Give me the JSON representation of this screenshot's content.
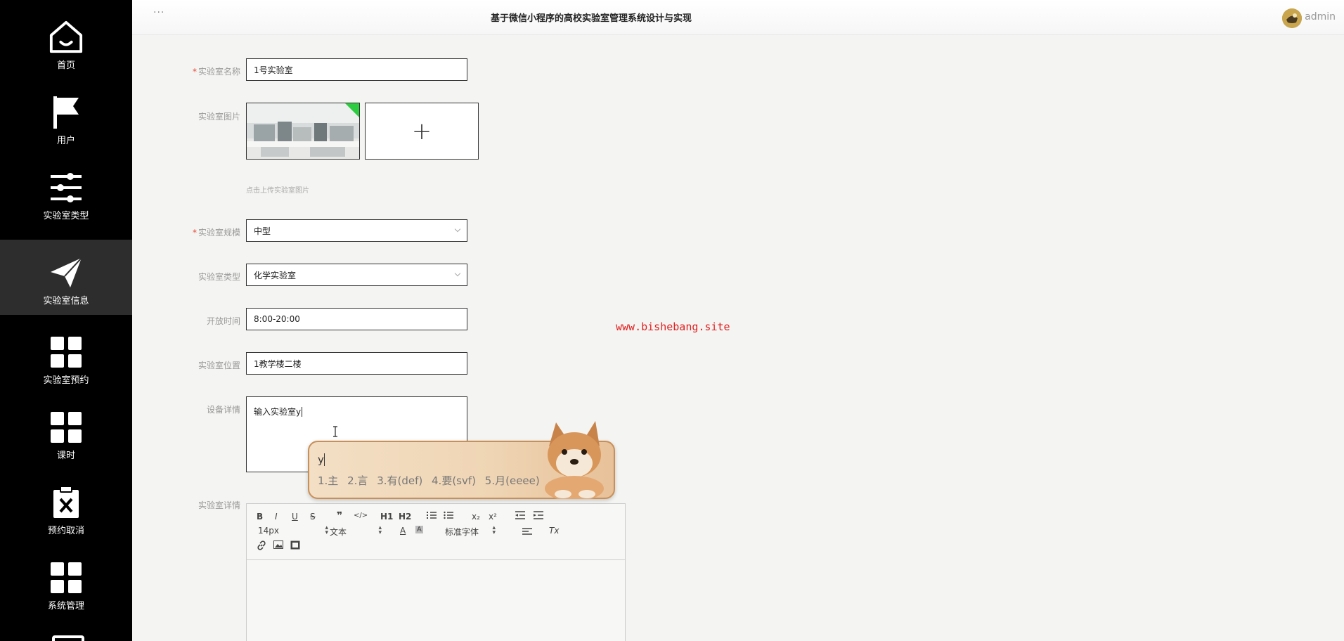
{
  "header": {
    "title": "基于微信小程序的高校实验室管理系统设计与实现",
    "menu_dots": "···",
    "user_name": "admin"
  },
  "sidebar": {
    "items": [
      {
        "label": "首页",
        "icon": "home-icon"
      },
      {
        "label": "用户",
        "icon": "flag-icon"
      },
      {
        "label": "实验室类型",
        "icon": "sliders-icon"
      },
      {
        "label": "实验室信息",
        "icon": "paper-plane-icon",
        "active": true
      },
      {
        "label": "实验室预约",
        "icon": "grid-icon"
      },
      {
        "label": "课时",
        "icon": "grid-icon"
      },
      {
        "label": "预约取消",
        "icon": "clipboard-x-icon"
      },
      {
        "label": "系统管理",
        "icon": "grid-icon"
      }
    ]
  },
  "form": {
    "name": {
      "label": "实验室名称",
      "value": "1号实验室",
      "required": true
    },
    "image": {
      "label": "实验室图片",
      "hint": "点击上传实验室图片",
      "add_symbol": "+"
    },
    "scale": {
      "label": "实验室规模",
      "value": "中型",
      "required": true
    },
    "type": {
      "label": "实验室类型",
      "value": "化学实验室"
    },
    "open_time": {
      "label": "开放时间",
      "value": "8:00-20:00"
    },
    "location": {
      "label": "实验室位置",
      "value": "1教学楼二楼"
    },
    "equipment": {
      "label": "设备详情",
      "value": "输入实验室y"
    },
    "details": {
      "label": "实验室详情"
    }
  },
  "ime": {
    "input": "y",
    "candidates": [
      "1.主",
      "2.言",
      "3.有(def)",
      "4.要(svf)",
      "5.月(eeee)"
    ]
  },
  "watermark": "www.bishebang.site",
  "editor": {
    "bold": "B",
    "italic": "I",
    "underline": "U",
    "strike": "S",
    "quote": "❞",
    "code": "</>",
    "h1": "H1",
    "h2": "H2",
    "sub": "x₂",
    "sup": "x²",
    "font_size": "14px",
    "text_style": "文本",
    "font_family": "标准字体",
    "clean": "Tx"
  },
  "colors": {
    "sidebar_bg": "#000000",
    "sidebar_active": "#2d2d2d",
    "required": "#e74c3c",
    "watermark": "#e02020"
  }
}
